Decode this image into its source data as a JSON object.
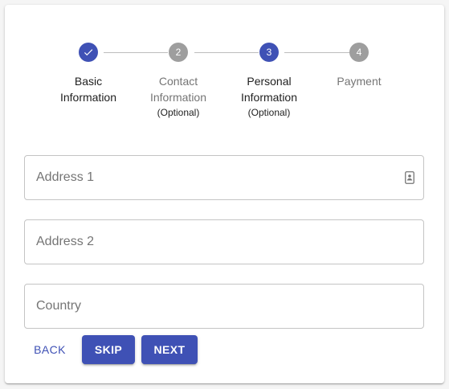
{
  "stepper": {
    "steps": [
      {
        "index": "1",
        "label_line1": "Basic",
        "label_line2": "Information",
        "optional": "",
        "state": "completed",
        "icon": "check-icon"
      },
      {
        "index": "2",
        "label_line1": "Contact",
        "label_line2": "Information",
        "optional": "(Optional)",
        "state": "inactive"
      },
      {
        "index": "3",
        "label_line1": "Personal",
        "label_line2": "Information",
        "optional": "(Optional)",
        "state": "active"
      },
      {
        "index": "4",
        "label_line1": "Payment",
        "label_line2": "",
        "optional": "",
        "state": "inactive"
      }
    ]
  },
  "form": {
    "address1": {
      "placeholder": "Address 1",
      "value": "",
      "icon": "contact-card-icon"
    },
    "address2": {
      "placeholder": "Address 2",
      "value": ""
    },
    "country": {
      "placeholder": "Country",
      "value": ""
    }
  },
  "actions": {
    "back_label": "BACK",
    "skip_label": "SKIP",
    "next_label": "NEXT"
  },
  "colors": {
    "primary": "#3f51b5",
    "inactive": "#9e9e9e",
    "border": "#c4c4c4"
  }
}
